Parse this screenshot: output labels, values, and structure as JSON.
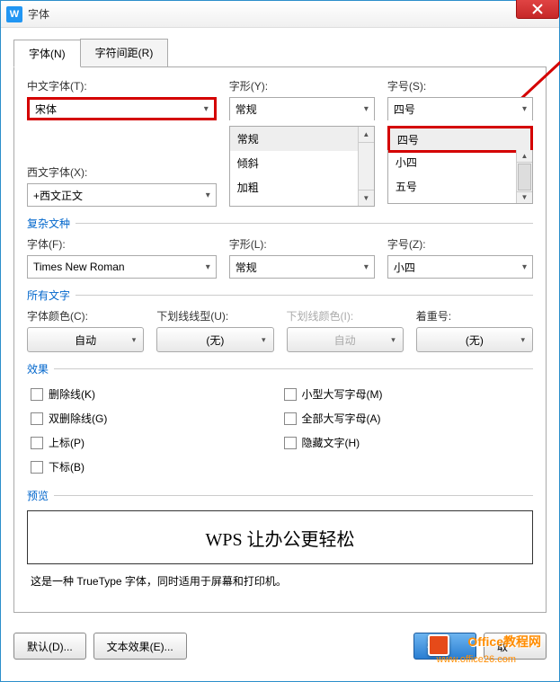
{
  "titlebar": {
    "icon_letter": "W",
    "title": "字体"
  },
  "tabs": {
    "font": "字体(N)",
    "spacing": "字符间距(R)"
  },
  "chinese_font": {
    "label": "中文字体(T):",
    "value": "宋体"
  },
  "style": {
    "label": "字形(Y):",
    "value": "常规",
    "options": [
      "常规",
      "倾斜",
      "加粗"
    ]
  },
  "size": {
    "label": "字号(S):",
    "value": "四号",
    "options": [
      "四号",
      "小四",
      "五号"
    ]
  },
  "western_font": {
    "label": "西文字体(X):",
    "value": "+西文正文"
  },
  "complex": {
    "group": "复杂文种",
    "font_label": "字体(F):",
    "font_value": "Times New Roman",
    "style_label": "字形(L):",
    "style_value": "常规",
    "size_label": "字号(Z):",
    "size_value": "小四"
  },
  "all_text": {
    "group": "所有文字",
    "color_label": "字体颜色(C):",
    "color_value": "自动",
    "underline_label": "下划线线型(U):",
    "underline_value": "(无)",
    "underline_color_label": "下划线颜色(I):",
    "underline_color_value": "自动",
    "emphasis_label": "着重号:",
    "emphasis_value": "(无)"
  },
  "effects": {
    "group": "效果",
    "strike": "删除线(K)",
    "dstrike": "双删除线(G)",
    "super": "上标(P)",
    "sub": "下标(B)",
    "smallcaps": "小型大写字母(M)",
    "allcaps": "全部大写字母(A)",
    "hidden": "隐藏文字(H)"
  },
  "preview": {
    "group": "预览",
    "text": "WPS 让办公更轻松"
  },
  "hint": "这是一种 TrueType 字体，同时适用于屏幕和打印机。",
  "footer": {
    "default": "默认(D)...",
    "effects": "文本效果(E)...",
    "ok_partial": "确",
    "cancel_partial": "取"
  },
  "watermark": {
    "brand": "Office教程网",
    "url": "www.office26.com"
  }
}
